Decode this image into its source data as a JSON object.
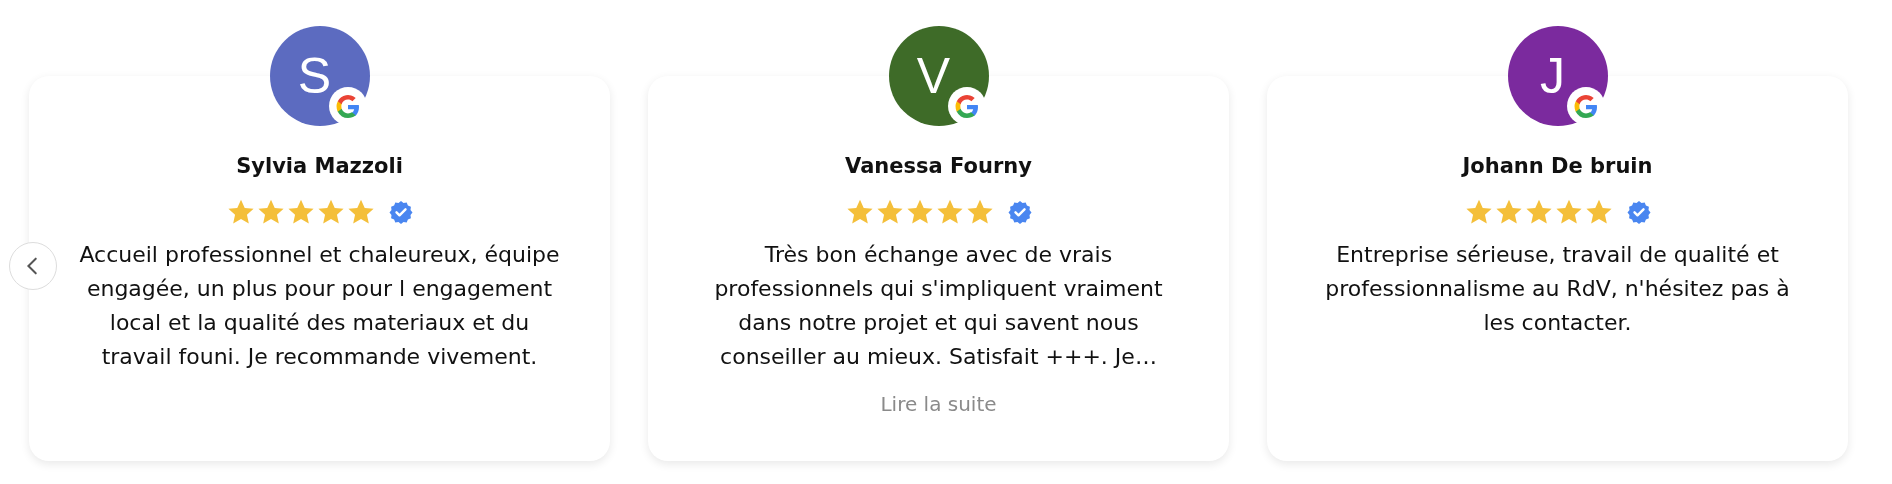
{
  "reviews": [
    {
      "initial": "S",
      "color": "#5c6bc0",
      "name": "Sylvia Mazzoli",
      "stars": 5,
      "verified": true,
      "text": "Accueil professionnel et chaleureux, équipe engagée, un plus pour pour l engagement local et la qualité des materiaux et du travail founi. Je recommande vivement."
    },
    {
      "initial": "V",
      "color": "#3e6b28",
      "name": "Vanessa Fourny",
      "stars": 5,
      "verified": true,
      "text": "Très bon échange avec de vrais professionnels qui s'impliquent vraiment dans notre projet et qui savent nous conseiller au mieux. Satisfait +++. Je…",
      "read_more": "Lire la suite"
    },
    {
      "initial": "J",
      "color": "#7b2a9e",
      "name": "Johann De bruin",
      "stars": 5,
      "verified": true,
      "text": "Entreprise sérieuse, travail de qualité et professionnalisme au RdV, n'hésitez pas à les contacter."
    }
  ]
}
